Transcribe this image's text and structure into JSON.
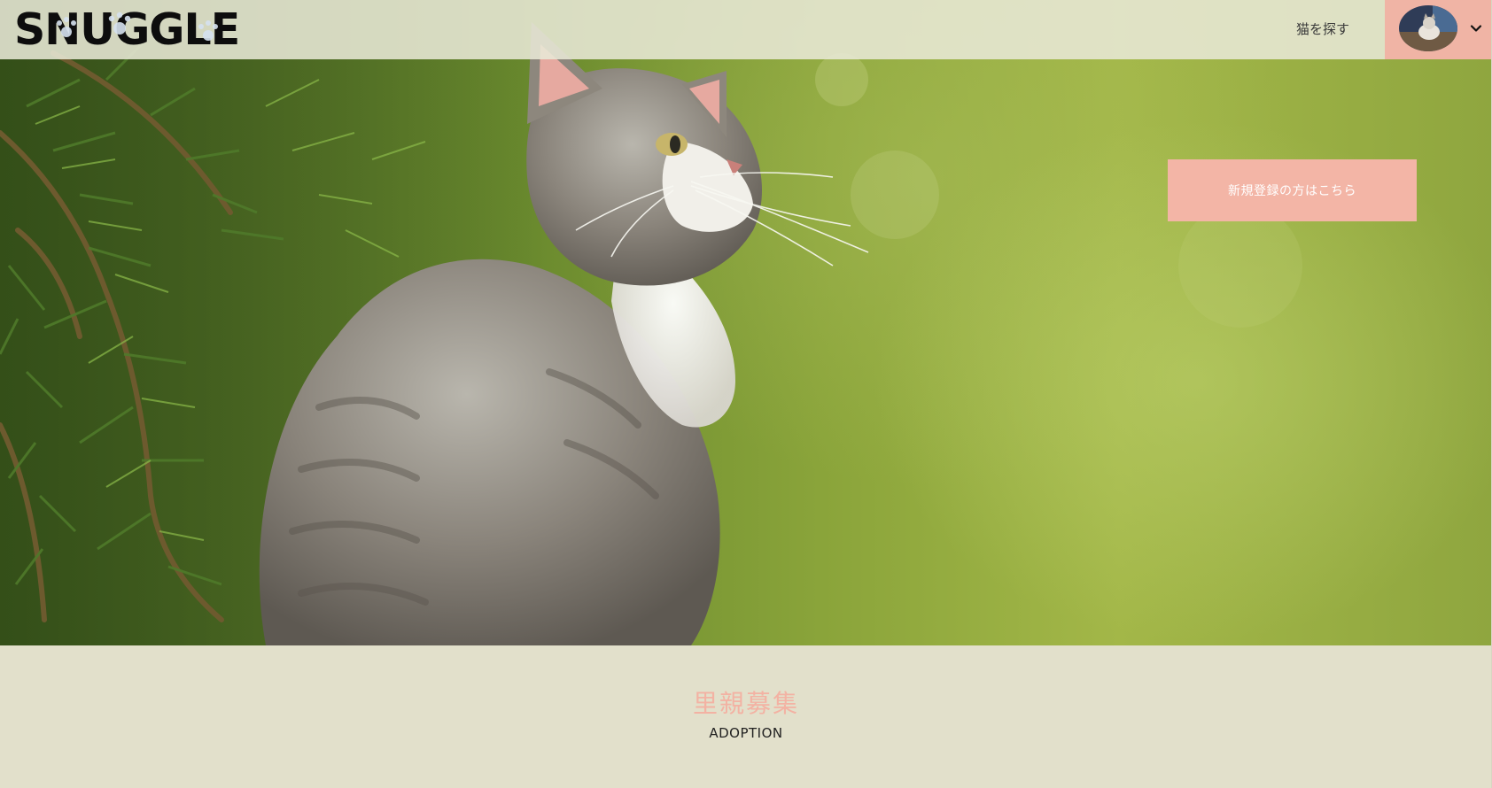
{
  "brand": {
    "logo_text": "SNUGGLE"
  },
  "header": {
    "nav_find_cats": "猫を探す",
    "user_avatar": "user-avatar-cat-photo",
    "user_menu_icon": "chevron-down-icon"
  },
  "hero": {
    "image": "kitten-photo",
    "cta_label": "新規登録の方はこちら"
  },
  "section": {
    "title": "里親募集",
    "subtitle": "ADOPTION"
  },
  "colors": {
    "accent_pink": "#f3b5a6",
    "section_bg": "#e2e0cb",
    "header_bg": "#e8e8d6"
  }
}
